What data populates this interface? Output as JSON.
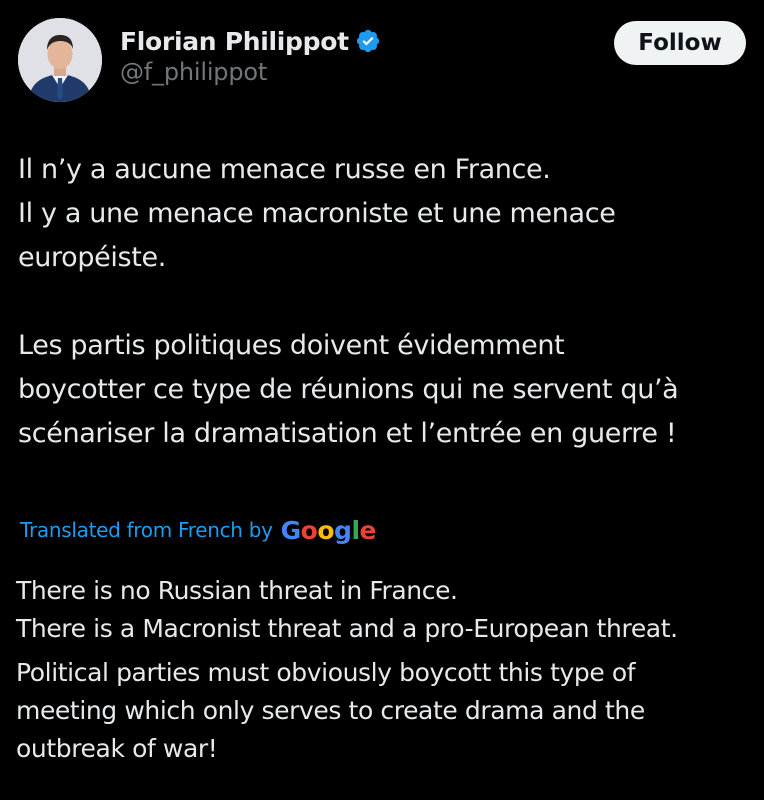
{
  "author": {
    "display_name": "Florian Philippot",
    "handle": "@f_philippot",
    "verified_icon": "verified-badge-icon",
    "verified_color": "#1d9bf0"
  },
  "follow_button": {
    "label": "Follow"
  },
  "tweet": {
    "paragraphs": [
      {
        "lines": [
          "Il n’y a aucune menace russe en France.",
          "Il y a une menace macroniste et une menace",
          "européiste."
        ]
      },
      {
        "lines": [
          "Les partis politiques doivent évidemment",
          "boycotter ce type de réunions qui ne servent qu’à",
          "scénariser la dramatisation et l’entrée en guerre !"
        ]
      }
    ]
  },
  "translation": {
    "label": "Translated from French by",
    "provider": "Google",
    "provider_colors": [
      "#4285f4",
      "#ea4335",
      "#fbbc05",
      "#4285f4",
      "#34a853",
      "#ea4335"
    ],
    "paragraphs": [
      {
        "lines": [
          "There is no Russian threat in France.",
          "There is a Macronist threat and a pro-European threat."
        ]
      },
      {
        "lines": [
          "Political parties must obviously boycott this type of",
          "meeting which only serves to create drama and the",
          "outbreak of war!"
        ]
      }
    ]
  },
  "colors": {
    "background": "#000000",
    "text": "#e7e9ea",
    "secondary_text": "#71767b",
    "accent": "#1d9bf0",
    "button_bg": "#eff3f4"
  }
}
